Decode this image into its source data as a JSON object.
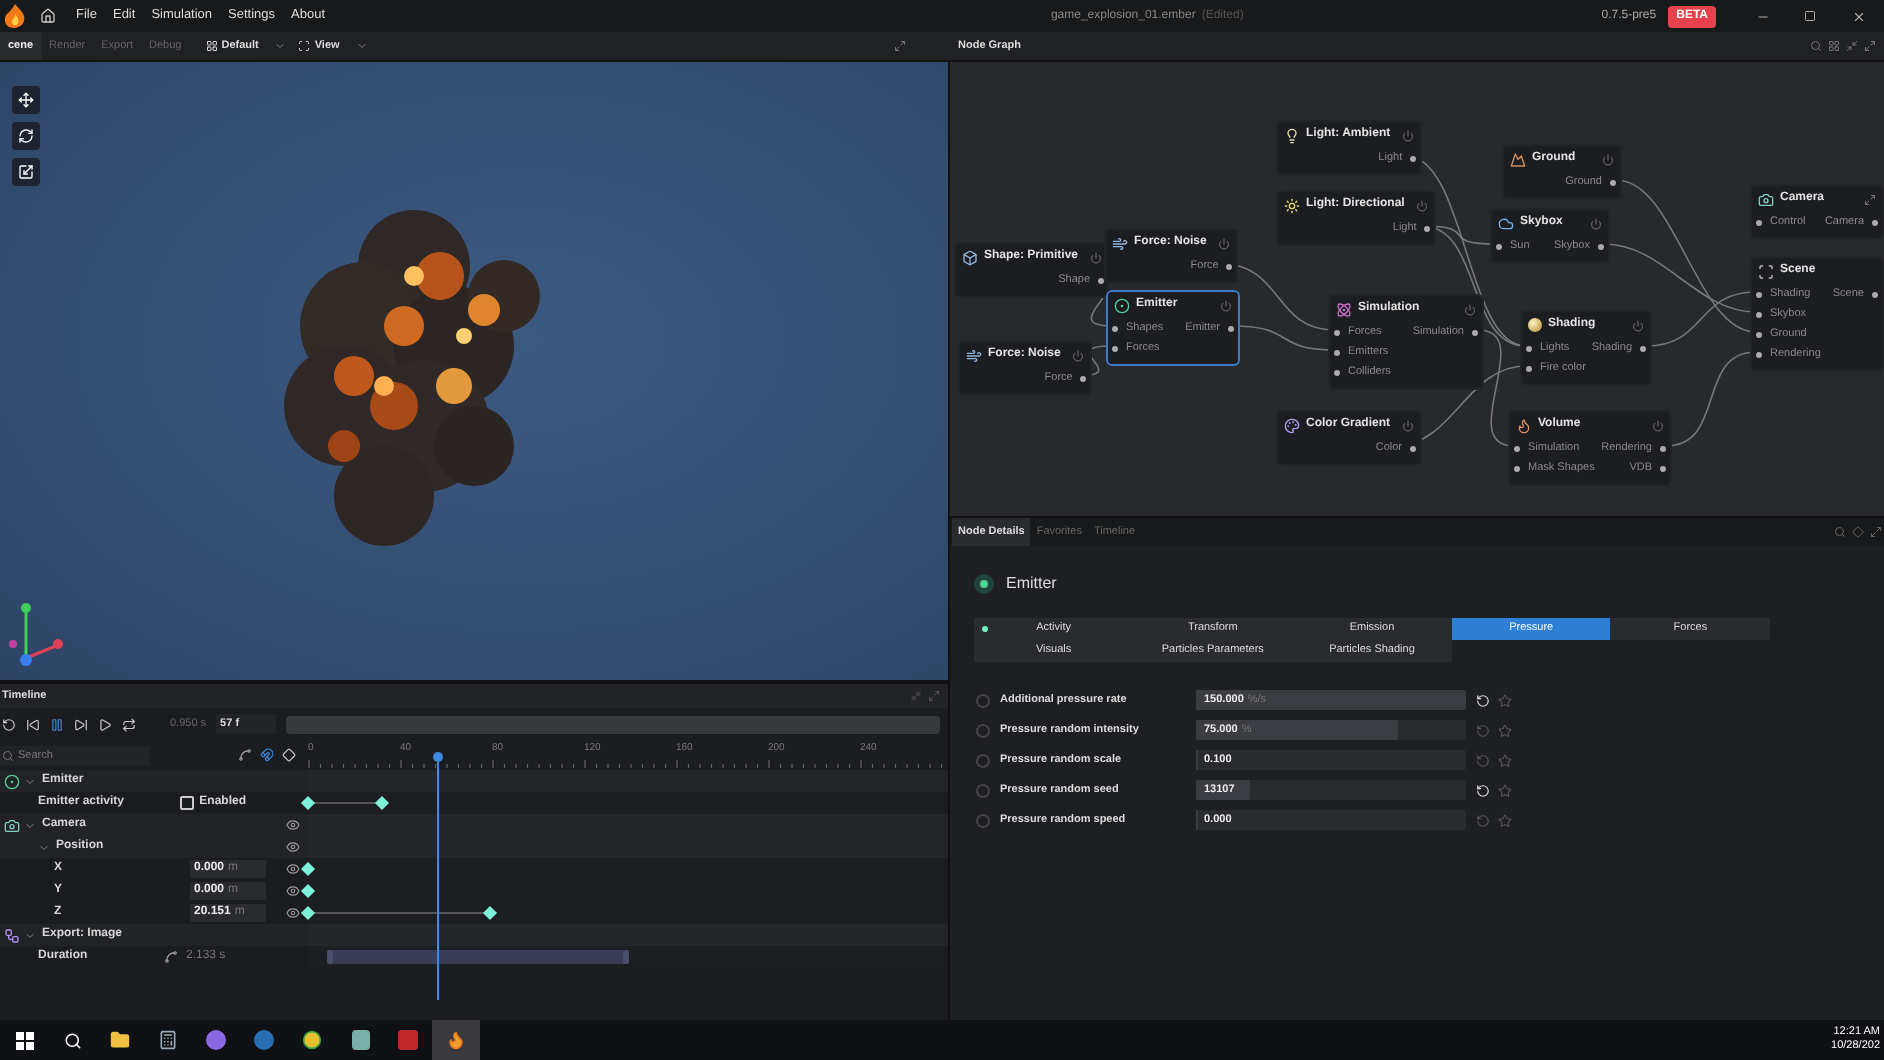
{
  "title_bar": {
    "menus": [
      "File",
      "Edit",
      "Simulation",
      "Settings",
      "About"
    ],
    "file_name": "game_explosion_01.ember",
    "file_state": "(Edited)",
    "version": "0.7.5-pre5",
    "badge": "BETA"
  },
  "toolbar": {
    "tabs": [
      {
        "label": "cene",
        "selected": true
      },
      {
        "label": "Render",
        "selected": false
      },
      {
        "label": "Export",
        "selected": false
      },
      {
        "label": "Debug",
        "selected": false
      }
    ],
    "layout": "Default",
    "view": "View",
    "panel_title": "Node Graph"
  },
  "node_graph": {
    "nodes": [
      {
        "title": "Shape: Primitive",
        "kind": "shape",
        "selected": false,
        "outputs": [
          "Shape"
        ]
      },
      {
        "title": "Force: Noise",
        "kind": "force",
        "selected": false,
        "outputs": [
          "Force"
        ]
      },
      {
        "title": "Emitter",
        "kind": "emitter",
        "selected": true,
        "inputs": [
          "Shapes",
          "Forces"
        ],
        "outputs": [
          "Emitter"
        ]
      },
      {
        "title": "Force: Noise",
        "kind": "force",
        "selected": false,
        "outputs": [
          "Force"
        ]
      },
      {
        "title": "Light: Ambient",
        "kind": "ambient",
        "selected": false,
        "outputs": [
          "Light"
        ]
      },
      {
        "title": "Light: Directional",
        "kind": "directional",
        "selected": false,
        "outputs": [
          "Light"
        ]
      },
      {
        "title": "Simulation",
        "kind": "simulation",
        "selected": false,
        "inputs": [
          "Forces",
          "Emitters",
          "Colliders"
        ],
        "outputs": [
          "Simulation"
        ]
      },
      {
        "title": "Color Gradient",
        "kind": "gradient",
        "selected": false,
        "outputs": [
          "Color"
        ]
      },
      {
        "title": "Ground",
        "kind": "ground",
        "selected": false,
        "outputs": [
          "Ground"
        ]
      },
      {
        "title": "Skybox",
        "kind": "skybox",
        "selected": false,
        "inputs": [
          "Sun"
        ],
        "outputs": [
          "Skybox"
        ]
      },
      {
        "title": "Shading",
        "kind": "shading",
        "selected": false,
        "inputs": [
          "Lights",
          "Fire color"
        ],
        "outputs": [
          "Shading"
        ]
      },
      {
        "title": "Volume",
        "kind": "volume",
        "selected": false,
        "inputs": [
          "Simulation",
          "Mask Shapes"
        ],
        "outputs": [
          "Rendering",
          "VDB"
        ]
      },
      {
        "title": "Camera",
        "kind": "camera",
        "selected": false,
        "inputs": [
          "Control"
        ],
        "outputs": [
          "Camera"
        ]
      },
      {
        "title": "Scene",
        "kind": "scene",
        "selected": false,
        "inputs": [
          "Shading",
          "Skybox",
          "Ground",
          "Rendering"
        ],
        "outputs": [
          "Scene"
        ]
      }
    ]
  },
  "node_details": {
    "tabs": [
      {
        "label": "Node Details",
        "selected": true
      },
      {
        "label": "Favorites",
        "selected": false
      },
      {
        "label": "Timeline",
        "selected": false
      }
    ],
    "node_title": "Emitter",
    "enabled": true,
    "categories": [
      {
        "label": "Activity",
        "selected": false
      },
      {
        "label": "Transform",
        "selected": false
      },
      {
        "label": "Emission",
        "selected": false
      },
      {
        "label": "Pressure",
        "selected": true
      },
      {
        "label": "Forces",
        "selected": false
      },
      {
        "label": "Visuals",
        "selected": false
      },
      {
        "label": "Particles Parameters",
        "selected": false
      },
      {
        "label": "Particles Shading",
        "selected": false
      }
    ],
    "properties": [
      {
        "label": "Additional pressure rate",
        "value": "150.000",
        "unit": "%/s",
        "level": 1,
        "modified": true,
        "selected": false
      },
      {
        "label": "Pressure random intensity",
        "value": "75.000",
        "unit": "%",
        "level": 0.75,
        "modified": false,
        "selected": false
      },
      {
        "label": "Pressure random scale",
        "value": "0.100",
        "level": 0,
        "modified": false,
        "selected": false
      },
      {
        "label": "Pressure random seed",
        "value": "13107",
        "level": 0.2,
        "modified": true,
        "selected": false
      },
      {
        "label": "Pressure random speed",
        "value": "0.000",
        "level": 0,
        "modified": false,
        "selected": false
      }
    ]
  },
  "timeline": {
    "title": "Timeline",
    "time": "0.950 s",
    "frame": "57 f",
    "search_placeholder": "Search",
    "ruler": [
      "0",
      "40",
      "80",
      "120",
      "160",
      "200",
      "240"
    ],
    "playhead": {
      "level": 0.205
    },
    "tracks": [
      {
        "kind": "group",
        "label": "Emitter",
        "expanded": true,
        "children": [
          {
            "kind": "checkbox",
            "label": "Emitter activity",
            "checkbox_label": "Enabled",
            "checked": false,
            "keys": [
              {
                "level": 0
              },
              {
                "level": 0.116
              }
            ]
          }
        ]
      },
      {
        "kind": "group",
        "label": "Camera",
        "expanded": true,
        "visible": true,
        "children": [
          {
            "kind": "group",
            "label": "Position",
            "expanded": true,
            "visible": true,
            "children": [
              {
                "kind": "value",
                "label": "X",
                "value": "0.000",
                "unit": "m",
                "visible": true,
                "keys": [
                  {
                    "level": 0
                  }
                ]
              },
              {
                "kind": "value",
                "label": "Y",
                "value": "0.000",
                "unit": "m",
                "visible": true,
                "keys": [
                  {
                    "level": 0
                  }
                ]
              },
              {
                "kind": "value",
                "label": "Z",
                "value": "20.151",
                "unit": "m",
                "visible": true,
                "keys": [
                  {
                    "level": 0
                  },
                  {
                    "level": 0.286
                  }
                ]
              }
            ]
          }
        ]
      },
      {
        "kind": "group",
        "label": "Export: Image",
        "expanded": true,
        "children": [
          {
            "kind": "duration",
            "label": "Duration",
            "value": "2.133 s",
            "range": [
              {
                "level": 0.035
              },
              {
                "level": 0.5
              }
            ]
          }
        ]
      }
    ]
  },
  "taskbar": {
    "time": "12:21 AM",
    "date": "10/28/202"
  }
}
